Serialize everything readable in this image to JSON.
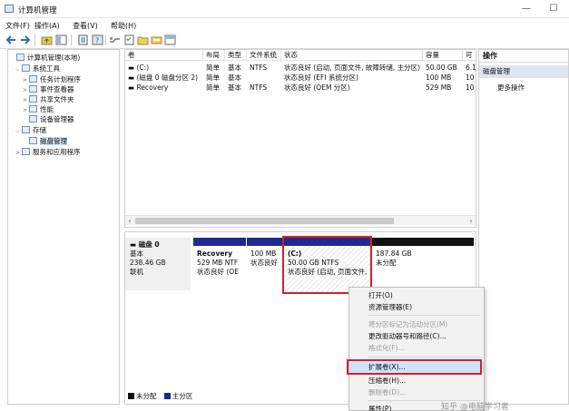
{
  "window": {
    "title": "计算机管理",
    "minimize": "—",
    "maximize": "☐"
  },
  "menu": [
    "文件(F)",
    "操作(A)",
    "查看(V)",
    "帮助(H)"
  ],
  "toolbar_icons": [
    "back-arrow-icon",
    "forward-arrow-icon",
    "folder-up-icon",
    "console-tree-icon",
    "properties-icon",
    "help-icon",
    "connect-icon",
    "checklist-icon",
    "folder-icon",
    "disk-icon",
    "view-icon"
  ],
  "tree": {
    "items": [
      {
        "label": "计算机管理(本地)",
        "exp": "",
        "level": 0
      },
      {
        "label": "系统工具",
        "exp": "⌵",
        "level": 1
      },
      {
        "label": "任务计划程序",
        "exp": ">",
        "level": 2
      },
      {
        "label": "事件查看器",
        "exp": ">",
        "level": 2
      },
      {
        "label": "共享文件夹",
        "exp": ">",
        "level": 2
      },
      {
        "label": "性能",
        "exp": ">",
        "level": 2
      },
      {
        "label": "设备管理器",
        "exp": "",
        "level": 2
      },
      {
        "label": "存储",
        "exp": "⌵",
        "level": 1
      },
      {
        "label": "磁盘管理",
        "exp": "",
        "level": 2
      },
      {
        "label": "服务和应用程序",
        "exp": ">",
        "level": 1
      }
    ]
  },
  "volumes": {
    "columns": [
      "卷",
      "布局",
      "类型",
      "文件系统",
      "状态",
      "容量",
      "可"
    ],
    "rows": [
      [
        "(C:)",
        "简单",
        "基本",
        "NTFS",
        "状态良好 (启动, 页面文件, 故障转储, 主分区)",
        "50.00 GB",
        "6.1"
      ],
      [
        "(磁盘 0 磁盘分区 2)",
        "简单",
        "基本",
        "",
        "状态良好 (EFI 系统分区)",
        "100 MB",
        "10"
      ],
      [
        "Recovery",
        "简单",
        "基本",
        "NTFS",
        "状态良好 (OEM 分区)",
        "529 MB",
        "10"
      ]
    ]
  },
  "actions": {
    "header": "操作",
    "section": "磁盘管理",
    "more": "更多操作"
  },
  "disk": {
    "name": "磁盘 0",
    "type": "基本",
    "size": "238.46 GB",
    "state": "联机",
    "partitions": [
      {
        "name": "Recovery",
        "size": "529 MB NTF",
        "status": "状态良好 (OE"
      },
      {
        "name": "",
        "size": "100 MB",
        "status": "状态良好"
      },
      {
        "name": "(C:)",
        "size": "50.00 GB NTFS",
        "status": "状态良好 (启动, 页面文件,"
      },
      {
        "name": "",
        "size": "187.84 GB",
        "status": "未分配"
      }
    ]
  },
  "legend": {
    "unallocated": "未分配",
    "primary": "主分区"
  },
  "context_menu": {
    "items": [
      {
        "label": "打开(O)",
        "disabled": false
      },
      {
        "label": "资源管理器(E)",
        "disabled": false
      },
      {
        "sep": true
      },
      {
        "label": "将分区标记为活动分区(M)",
        "disabled": true
      },
      {
        "label": "更改驱动器号和路径(C)...",
        "disabled": false
      },
      {
        "label": "格式化(F)...",
        "disabled": true
      },
      {
        "sep": true
      },
      {
        "label": "扩展卷(X)...",
        "disabled": false,
        "highlight": true
      },
      {
        "label": "压缩卷(H)...",
        "disabled": false
      },
      {
        "label": "删除卷(D)...",
        "disabled": true
      },
      {
        "sep": true
      },
      {
        "label": "属性(P)",
        "disabled": false
      }
    ]
  },
  "watermark": "知乎 @电脑学习者",
  "colors": {
    "primary_bar": "#1f2a8a",
    "unallocated_bar": "#111111",
    "highlight_box": "#d3202a",
    "selection": "#cce4f7"
  }
}
